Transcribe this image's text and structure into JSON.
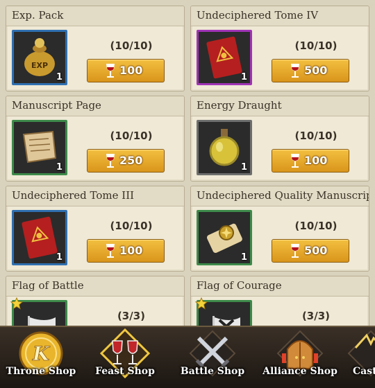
{
  "shop_items": [
    {
      "name": "Exp. Pack",
      "qty": "1",
      "stock": "(10/10)",
      "price": "100",
      "rarity": "blue",
      "icon": "exp-pack-icon"
    },
    {
      "name": "Undeciphered Tome IV",
      "qty": "1",
      "stock": "(10/10)",
      "price": "500",
      "rarity": "purple",
      "icon": "tome-icon"
    },
    {
      "name": "Manuscript Page",
      "qty": "1",
      "stock": "(10/10)",
      "price": "250",
      "rarity": "green",
      "icon": "manuscript-page-icon"
    },
    {
      "name": "Energy Draught",
      "qty": "1",
      "stock": "(10/10)",
      "price": "100",
      "rarity": "gray",
      "icon": "potion-icon"
    },
    {
      "name": "Undeciphered Tome III",
      "qty": "1",
      "stock": "(10/10)",
      "price": "100",
      "rarity": "blue",
      "icon": "tome-icon"
    },
    {
      "name": "Undeciphered Quality Manuscript",
      "qty": "1",
      "stock": "(10/10)",
      "price": "500",
      "rarity": "green",
      "icon": "scroll-icon"
    },
    {
      "name": "Flag of Battle",
      "stock": "(3/3)",
      "rarity": "green",
      "icon": "flag-icon"
    },
    {
      "name": "Flag of Courage",
      "stock": "(3/3)",
      "rarity": "green",
      "icon": "flag-icon"
    }
  ],
  "nav": {
    "throne_shop": "Throne Shop",
    "feast_shop": "Feast Shop",
    "battle_shop": "Battle Shop",
    "alliance_shop": "Alliance Shop",
    "castle_shop": "Cast"
  },
  "colors": {
    "rarity_blue": "#2f6fb0",
    "rarity_purple": "#a033b5",
    "rarity_green": "#3d8a4a",
    "rarity_gray": "#6e6e6e",
    "button_gold": "#e6a92a",
    "parchment": "#efe9d6"
  }
}
